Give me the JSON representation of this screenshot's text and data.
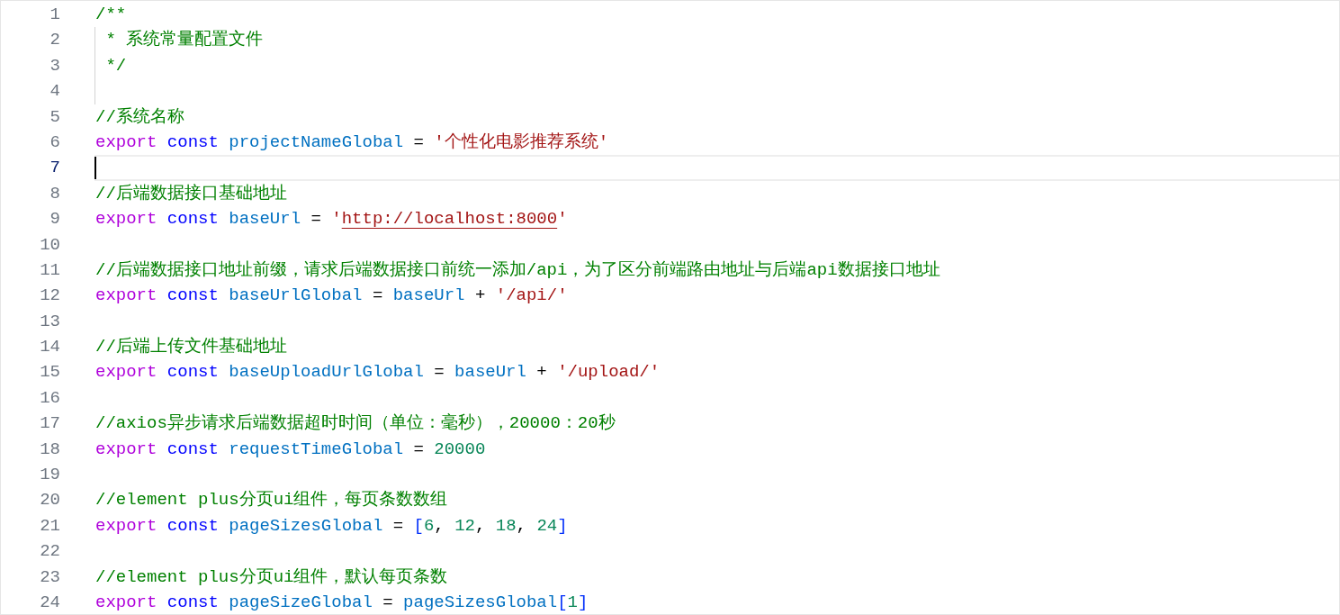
{
  "editor": {
    "lines": [
      {
        "number": "1",
        "current": false,
        "tokens": [
          {
            "kind": "comment",
            "text": "/**"
          }
        ]
      },
      {
        "number": "2",
        "current": false,
        "indent_guide": true,
        "tokens": [
          {
            "kind": "comment",
            "text": " * 系统常量配置文件"
          }
        ]
      },
      {
        "number": "3",
        "current": false,
        "indent_guide": true,
        "tokens": [
          {
            "kind": "comment",
            "text": " */"
          }
        ]
      },
      {
        "number": "4",
        "current": false,
        "indent_guide": true
      },
      {
        "number": "5",
        "current": false,
        "tokens": [
          {
            "kind": "comment",
            "text": "//系统名称"
          }
        ]
      },
      {
        "number": "6",
        "current": false,
        "tokens": [
          {
            "kind": "keyword",
            "text": "export "
          },
          {
            "kind": "storage",
            "text": "const "
          },
          {
            "kind": "variable",
            "text": "projectNameGlobal"
          },
          {
            "kind": "plain",
            "text": " = "
          },
          {
            "kind": "string",
            "text": "'个性化电影推荐系统'"
          }
        ]
      },
      {
        "number": "7",
        "current": true
      },
      {
        "number": "8",
        "current": false,
        "tokens": [
          {
            "kind": "comment",
            "text": "//后端数据接口基础地址"
          }
        ]
      },
      {
        "number": "9",
        "current": false,
        "tokens": [
          {
            "kind": "keyword",
            "text": "export "
          },
          {
            "kind": "storage",
            "text": "const "
          },
          {
            "kind": "variable",
            "text": "baseUrl"
          },
          {
            "kind": "plain",
            "text": " = "
          },
          {
            "kind": "string",
            "text": "'"
          },
          {
            "kind": "link",
            "text": "http://localhost:8000"
          },
          {
            "kind": "string",
            "text": "'"
          }
        ]
      },
      {
        "number": "10",
        "current": false
      },
      {
        "number": "11",
        "current": false,
        "tokens": [
          {
            "kind": "comment",
            "text": "//后端数据接口地址前缀，请求后端数据接口前统一添加/api，为了区分前端路由地址与后端api数据接口地址"
          }
        ]
      },
      {
        "number": "12",
        "current": false,
        "tokens": [
          {
            "kind": "keyword",
            "text": "export "
          },
          {
            "kind": "storage",
            "text": "const "
          },
          {
            "kind": "variable",
            "text": "baseUrlGlobal"
          },
          {
            "kind": "plain",
            "text": " = "
          },
          {
            "kind": "variable",
            "text": "baseUrl"
          },
          {
            "kind": "plain",
            "text": " + "
          },
          {
            "kind": "string",
            "text": "'/api/'"
          }
        ]
      },
      {
        "number": "13",
        "current": false
      },
      {
        "number": "14",
        "current": false,
        "tokens": [
          {
            "kind": "comment",
            "text": "//后端上传文件基础地址"
          }
        ]
      },
      {
        "number": "15",
        "current": false,
        "tokens": [
          {
            "kind": "keyword",
            "text": "export "
          },
          {
            "kind": "storage",
            "text": "const "
          },
          {
            "kind": "variable",
            "text": "baseUploadUrlGlobal"
          },
          {
            "kind": "plain",
            "text": " = "
          },
          {
            "kind": "variable",
            "text": "baseUrl"
          },
          {
            "kind": "plain",
            "text": " + "
          },
          {
            "kind": "string",
            "text": "'/upload/'"
          }
        ]
      },
      {
        "number": "16",
        "current": false
      },
      {
        "number": "17",
        "current": false,
        "tokens": [
          {
            "kind": "comment",
            "text": "//axios异步请求后端数据超时时间（单位：毫秒），20000：20秒"
          }
        ]
      },
      {
        "number": "18",
        "current": false,
        "tokens": [
          {
            "kind": "keyword",
            "text": "export "
          },
          {
            "kind": "storage",
            "text": "const "
          },
          {
            "kind": "variable",
            "text": "requestTimeGlobal"
          },
          {
            "kind": "plain",
            "text": " = "
          },
          {
            "kind": "number",
            "text": "20000"
          }
        ]
      },
      {
        "number": "19",
        "current": false
      },
      {
        "number": "20",
        "current": false,
        "tokens": [
          {
            "kind": "comment",
            "text": "//element plus分页ui组件，每页条数数组"
          }
        ]
      },
      {
        "number": "21",
        "current": false,
        "tokens": [
          {
            "kind": "keyword",
            "text": "export "
          },
          {
            "kind": "storage",
            "text": "const "
          },
          {
            "kind": "variable",
            "text": "pageSizesGlobal"
          },
          {
            "kind": "plain",
            "text": " = "
          },
          {
            "kind": "bracket",
            "text": "["
          },
          {
            "kind": "number",
            "text": "6"
          },
          {
            "kind": "plain",
            "text": ", "
          },
          {
            "kind": "number",
            "text": "12"
          },
          {
            "kind": "plain",
            "text": ", "
          },
          {
            "kind": "number",
            "text": "18"
          },
          {
            "kind": "plain",
            "text": ", "
          },
          {
            "kind": "number",
            "text": "24"
          },
          {
            "kind": "bracket",
            "text": "]"
          }
        ]
      },
      {
        "number": "22",
        "current": false
      },
      {
        "number": "23",
        "current": false,
        "tokens": [
          {
            "kind": "comment",
            "text": "//element plus分页ui组件，默认每页条数"
          }
        ]
      },
      {
        "number": "24",
        "current": false,
        "tokens": [
          {
            "kind": "keyword",
            "text": "export "
          },
          {
            "kind": "storage",
            "text": "const "
          },
          {
            "kind": "variable",
            "text": "pageSizeGlobal"
          },
          {
            "kind": "plain",
            "text": " = "
          },
          {
            "kind": "variable",
            "text": "pageSizesGlobal"
          },
          {
            "kind": "bracket",
            "text": "["
          },
          {
            "kind": "number",
            "text": "1"
          },
          {
            "kind": "bracket",
            "text": "]"
          }
        ]
      }
    ]
  }
}
